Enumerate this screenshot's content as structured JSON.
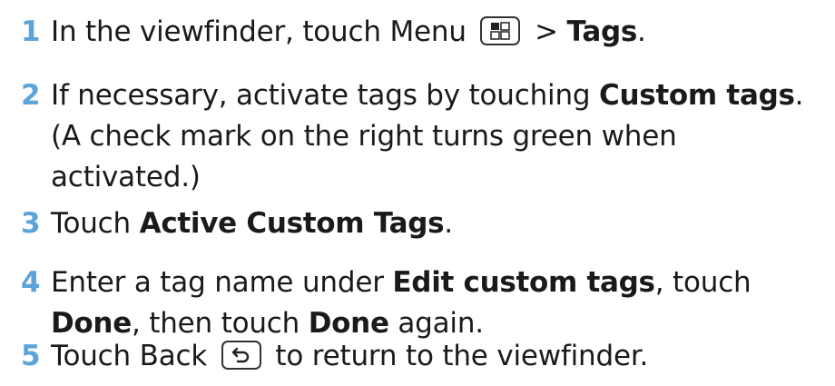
{
  "steps": [
    {
      "number": "1",
      "segments": [
        {
          "text": "In the viewfinder, touch Menu "
        },
        {
          "icon": "menu-icon"
        },
        {
          "text": " > "
        },
        {
          "text": "Tags",
          "bold": true
        },
        {
          "text": "."
        }
      ]
    },
    {
      "number": "2",
      "lines": [
        [
          {
            "text": "If necessary, activate tags by touching "
          },
          {
            "text": "Custom tags",
            "bold": true
          },
          {
            "text": "."
          }
        ],
        [
          {
            "text": "(A check mark on the right turns green when"
          }
        ],
        [
          {
            "text": "activated.)"
          }
        ]
      ]
    },
    {
      "number": "3",
      "segments": [
        {
          "text": "Touch "
        },
        {
          "text": "Active Custom Tags",
          "bold": true
        },
        {
          "text": "."
        }
      ]
    },
    {
      "number": "4",
      "lines": [
        [
          {
            "text": "Enter a tag name under "
          },
          {
            "text": "Edit custom tags",
            "bold": true
          },
          {
            "text": ", touch"
          }
        ],
        [
          {
            "text": "Done",
            "bold": true
          },
          {
            "text": ", then touch "
          },
          {
            "text": "Done",
            "bold": true
          },
          {
            "text": " again."
          }
        ]
      ]
    },
    {
      "number": "5",
      "segments": [
        {
          "text": "Touch Back "
        },
        {
          "icon": "back-icon"
        },
        {
          "text": " to return to the viewfinder."
        }
      ]
    }
  ],
  "colors": {
    "step_number": "#5ba3d9",
    "text": "#1a1a1a",
    "icon_border": "#333333"
  }
}
